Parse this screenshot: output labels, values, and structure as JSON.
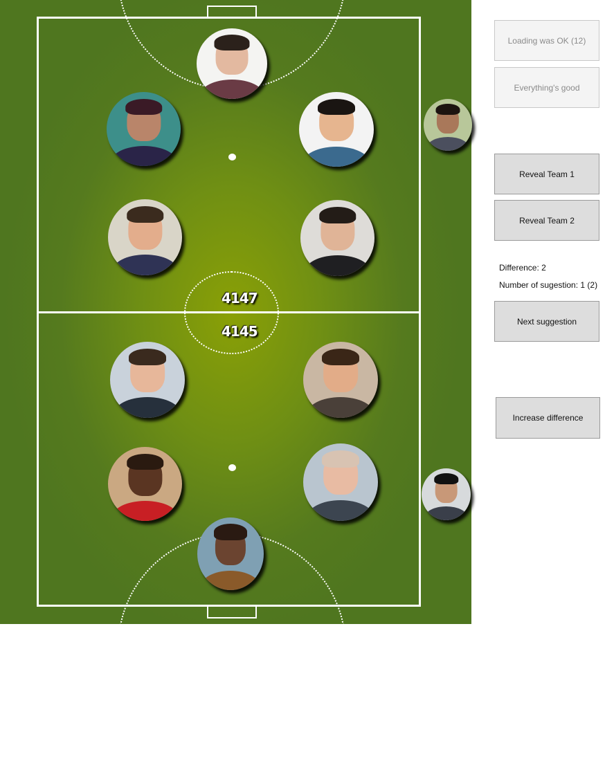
{
  "scores": {
    "team1": "4147",
    "team2": "4145"
  },
  "buttons": {
    "loading_status": "Loading was OK (12)",
    "everything_status": "Everything's good",
    "reveal_team1": "Reveal Team 1",
    "reveal_team2": "Reveal Team 2",
    "next_suggestion": "Next suggestion",
    "increase_difference": "Increase difference"
  },
  "info": {
    "difference": "Difference: 2",
    "suggestion_count": "Number of sugestion: 1 (2)"
  },
  "colors": {
    "pitch": "#6f8f14",
    "accent_center": "#8aa006",
    "lines": "#ffffff",
    "button_bg": "#dddddd"
  }
}
